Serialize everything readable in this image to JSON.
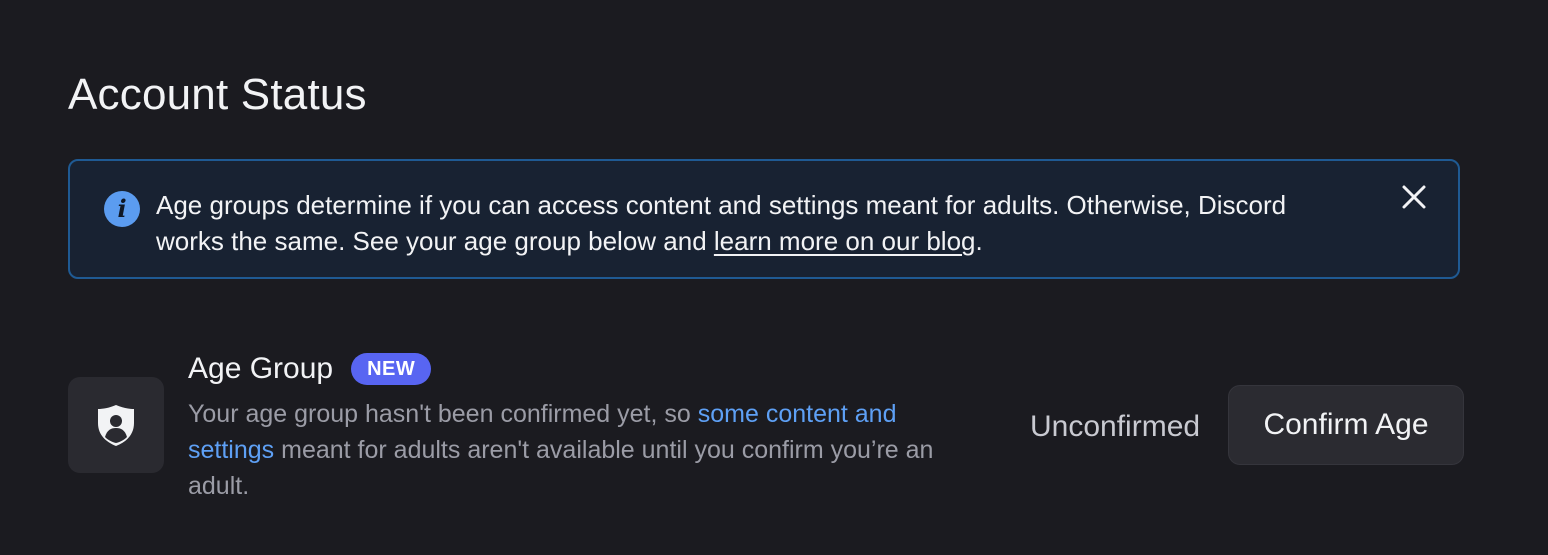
{
  "page": {
    "title": "Account Status"
  },
  "banner": {
    "text_before_link": "Age groups determine if you can access content and settings meant for adults. Otherwise, Discord works the same. See your age group below and ",
    "link_text": "learn more on our blog",
    "text_after_link": ".",
    "icon": "info-icon",
    "close_icon": "close-icon"
  },
  "age_group": {
    "title": "Age Group",
    "badge": "NEW",
    "desc_before_link": "Your age group hasn't been confirmed yet, so ",
    "desc_link": "some content and settings",
    "desc_after_link": " meant for adults aren't available until you confirm you’re an adult.",
    "status": "Unconfirmed",
    "button_label": "Confirm Age",
    "icon": "shield-user-icon"
  },
  "colors": {
    "background": "#1b1b20",
    "banner_border": "#1f5a93",
    "banner_bg": "#182232",
    "info_icon": "#5b9cf0",
    "badge": "#5865f2",
    "link": "#5ea0f5"
  }
}
